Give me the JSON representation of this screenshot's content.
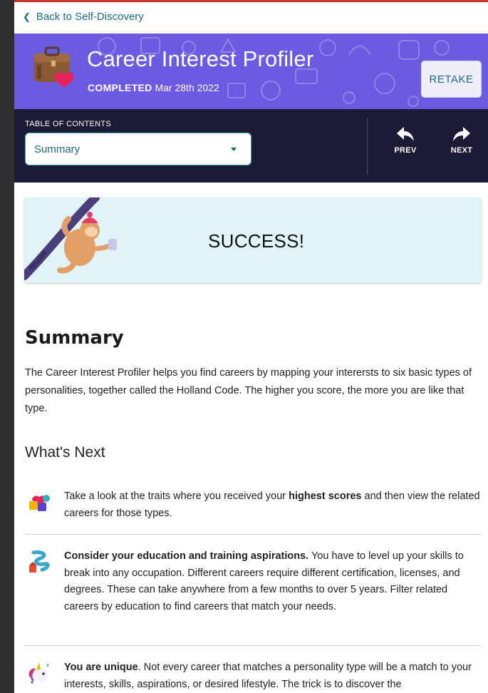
{
  "nav": {
    "back_label": "Back to Self-Discovery"
  },
  "header": {
    "title": "Career Interest Profiler",
    "status": "COMPLETED",
    "date": "Mar 28th 2022",
    "retake_label": "RETAKE",
    "banner_color": "#6b5be0"
  },
  "toc": {
    "label": "TABLE OF CONTENTS",
    "selected": "Summary",
    "prev_label": "PREV",
    "next_label": "NEXT",
    "bar_color": "#1b1b35"
  },
  "success": {
    "text": "SUCCESS!"
  },
  "summary": {
    "heading": "Summary",
    "body": "The Career Interest Profiler helps you find careers by mapping your interersts to six basic types of personalities, together called the Holland Code. The higher you score, the more you are like that type."
  },
  "whats_next": {
    "heading": "What's Next",
    "items": [
      {
        "icon": "puzzle-hearts-icon",
        "pre": "Take a look at the traits where you received your ",
        "bold": "highest scores",
        "post": " and then view the related careers for those types."
      },
      {
        "icon": "education-ladder-icon",
        "pre": "",
        "bold": "Consider your education and training aspirations.",
        "post": " You have to level up your skills to break into any occupation. Different careers require different certification, licenses, and degrees. These can take anywhere from a few months to over 5 years. Filter related careers by education to find careers that match your needs."
      },
      {
        "icon": "unicorn-icon",
        "pre": "",
        "bold": "You are unique",
        "post": ". Not every career that matches a personality type will be a match to your interests, skills, aspirations, or desired lifestyle. The trick is to discover the"
      }
    ]
  },
  "colors": {
    "link": "#1b6b80",
    "success_bg": "#e0f3f6"
  }
}
